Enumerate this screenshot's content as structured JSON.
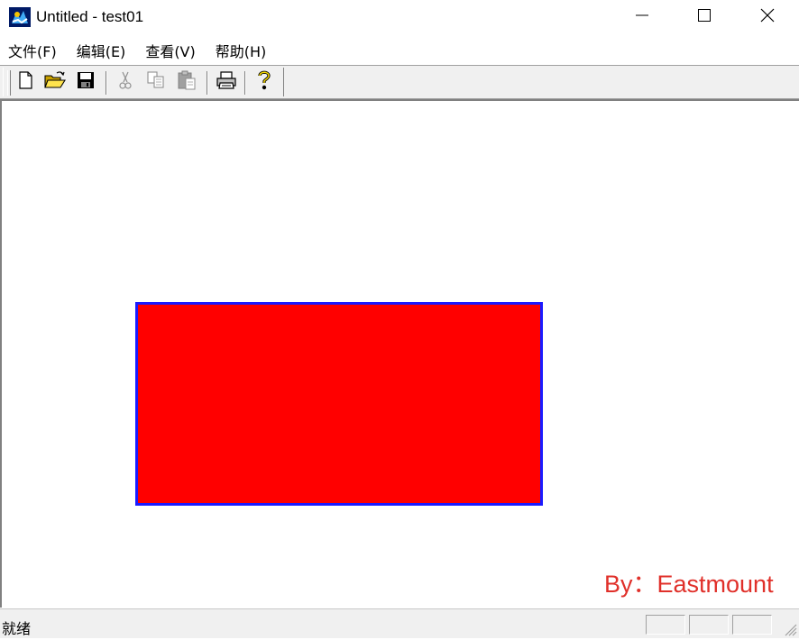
{
  "window": {
    "title": "Untitled - test01",
    "icons": [
      "app-icon",
      "minimize-icon",
      "maximize-icon",
      "close-icon"
    ]
  },
  "menu": {
    "items": [
      {
        "label": "文件(F)"
      },
      {
        "label": "编辑(E)"
      },
      {
        "label": "查看(V)"
      },
      {
        "label": "帮助(H)"
      }
    ]
  },
  "toolbar": {
    "buttons": [
      {
        "icon": "new-file-icon",
        "enabled": true
      },
      {
        "icon": "open-folder-icon",
        "enabled": true
      },
      {
        "icon": "save-icon",
        "enabled": true
      },
      {
        "icon": "cut-icon",
        "enabled": false
      },
      {
        "icon": "copy-icon",
        "enabled": false
      },
      {
        "icon": "paste-icon",
        "enabled": false
      },
      {
        "icon": "print-icon",
        "enabled": true
      },
      {
        "icon": "help-icon",
        "enabled": true
      }
    ]
  },
  "canvas": {
    "shape": {
      "type": "rectangle",
      "fill": "#ff0000",
      "stroke": "#1a1aff"
    },
    "watermark": "By：Eastmount"
  },
  "status": {
    "text": "就绪"
  },
  "colors": {
    "shape_fill": "#ff0000",
    "shape_stroke": "#1a1aff",
    "watermark": "#e0302a"
  }
}
